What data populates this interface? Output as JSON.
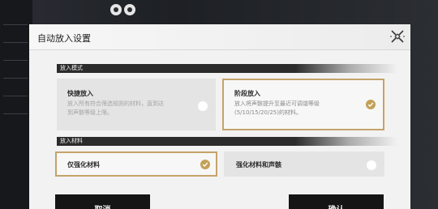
{
  "background": {
    "left_panel": {
      "labels": [
        "",
        "",
        "",
        "",
        "",
        ""
      ],
      "bottom_text": ""
    }
  },
  "dialog": {
    "title": "自动放入设置",
    "close_icon": "close-x-icon",
    "section_mode": {
      "label": "放入模式",
      "options": [
        {
          "title": "快捷放入",
          "description_line1": "放入所有符合筛选规则的材料，直到达",
          "description_line2": "到声骸等级上限。",
          "selected": false
        },
        {
          "title": "阶段放入",
          "description_line1": "放入将声骸提升至最近可调谐等级",
          "description_line2": "(5/10/15/20/25)的材料。",
          "selected": true
        }
      ]
    },
    "section_material": {
      "label": "放入材料",
      "options": [
        {
          "title": "仅强化材料",
          "selected": true
        },
        {
          "title": "强化材料和声骸",
          "selected": false
        }
      ]
    },
    "buttons": {
      "cancel_label": "取消",
      "confirm_label": "确认"
    }
  },
  "colors": {
    "accent_gold": "#c4a058",
    "selected_border": "#c4a46a",
    "section_header": "#2b2b2b",
    "button_bg": "#151515"
  }
}
